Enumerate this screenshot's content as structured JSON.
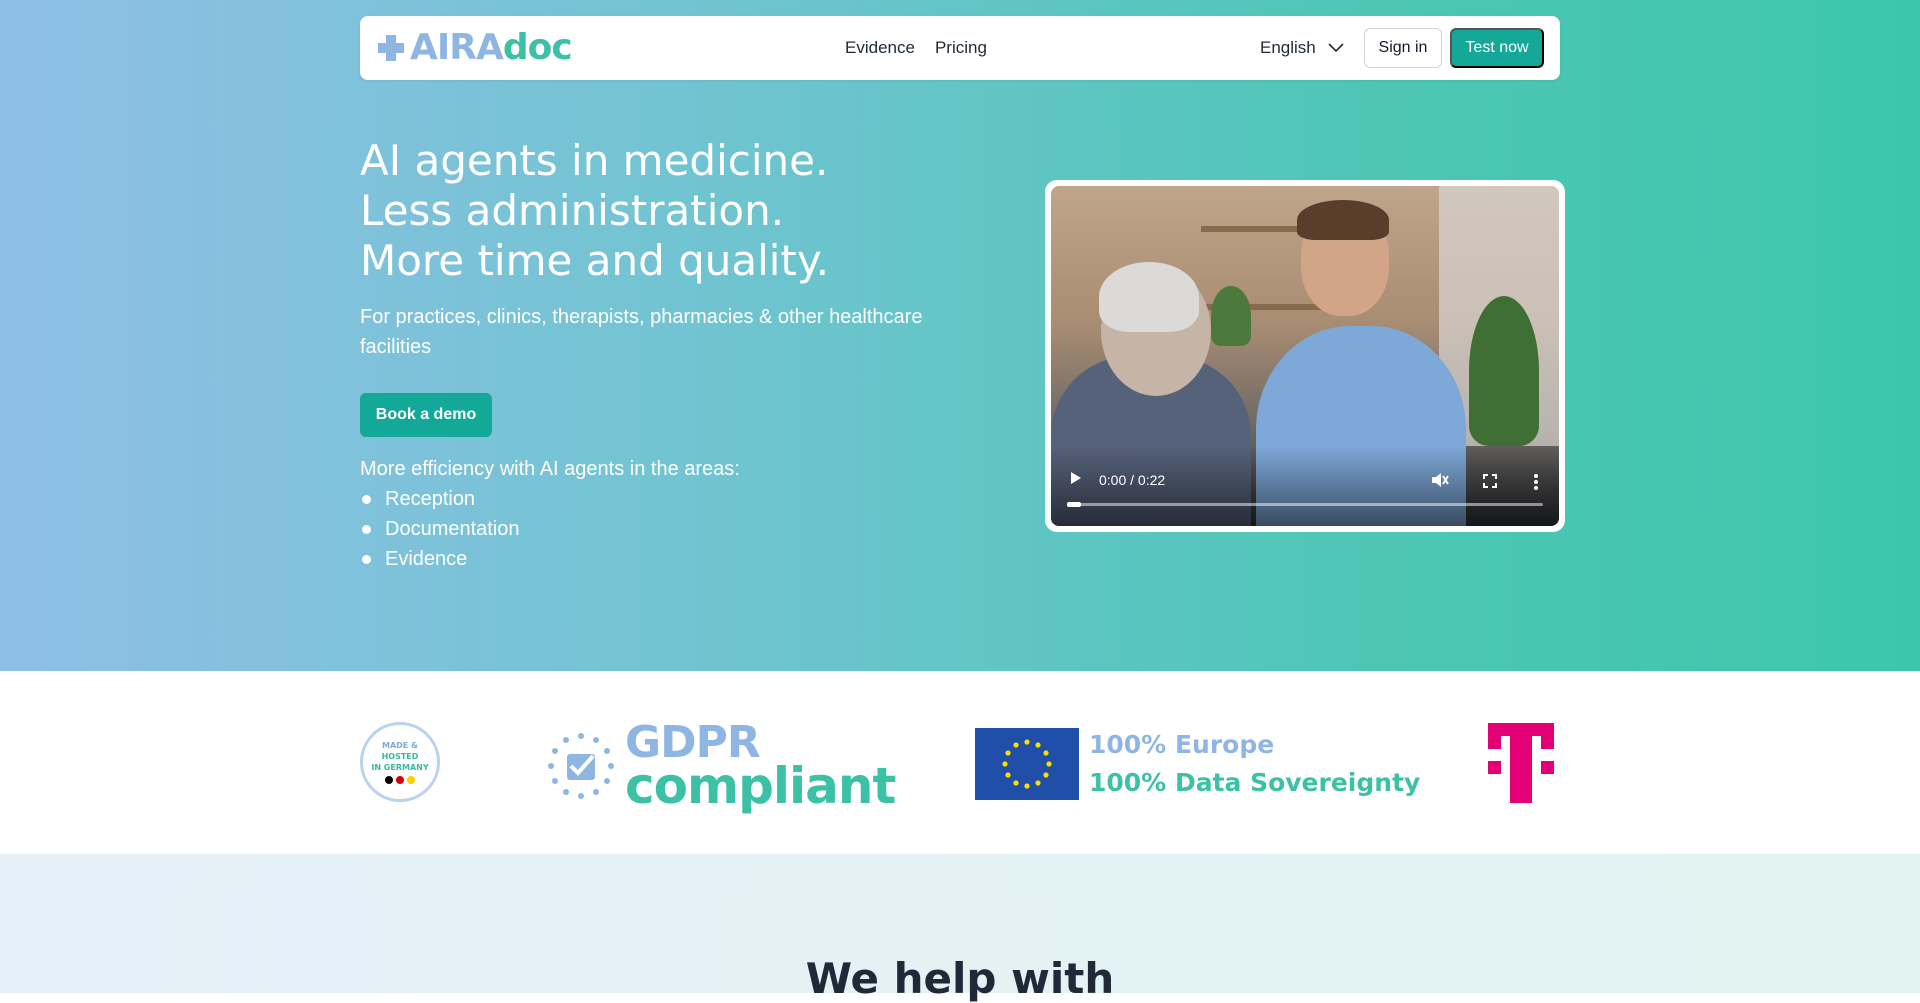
{
  "nav": {
    "logo_part1": "AIRA",
    "logo_part2": "doc",
    "links": [
      "Evidence",
      "Pricing"
    ],
    "language": "English",
    "signin_label": "Sign in",
    "test_label": "Test now"
  },
  "hero": {
    "headline": [
      "AI agents in medicine.",
      "Less administration.",
      "More time and quality."
    ],
    "subtitle": "For practices, clinics, therapists, pharmacies & other healthcare facilities",
    "demo_label": "Book a demo",
    "areas_intro": "More efficiency with AI agents in the areas:",
    "areas": [
      "Reception",
      "Documentation",
      "Evidence"
    ]
  },
  "video": {
    "time": "0:00 / 0:22",
    "progress": 0.0
  },
  "trust": {
    "germany_badge": [
      "MADE &",
      "HOSTED",
      "IN GERMANY"
    ],
    "gdpr_line1": "GDPR",
    "gdpr_line2": "compliant",
    "eu_line1": "100% Europe",
    "eu_line2": "100% Data Sovereignty"
  },
  "help": {
    "title": "We help with"
  },
  "colors": {
    "accent": "#14a898",
    "logo_blue": "#8fb6e3",
    "logo_teal": "#3cc1a6",
    "telekom_magenta": "#e20074",
    "eu_blue": "#1f4fa8",
    "eu_gold": "#ffdd00"
  },
  "icons": {
    "logo": "medical-cross-icon",
    "language_toggle": "chevron-down-icon",
    "play": "play-icon",
    "mute": "volume-off-icon",
    "fullscreen": "fullscreen-icon",
    "more": "more-vert-icon",
    "bullet": "bullet-icon",
    "gdpr_badge": "gdpr-stars-check-icon",
    "eu_flag": "eu-flag-icon",
    "telekom": "telekom-t-logo"
  }
}
